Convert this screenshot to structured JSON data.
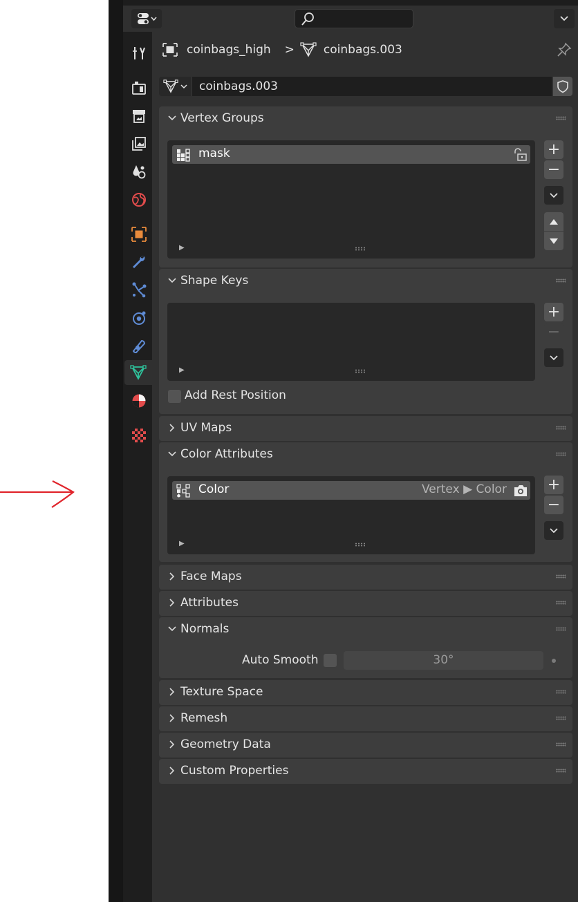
{
  "header": {
    "editor_type_icon": "properties-editor-icon",
    "search_placeholder": "",
    "search_icon": "search-icon",
    "options_icon": "chevron-down-icon"
  },
  "breadcrumb": {
    "object_name": "coinbags_high",
    "separator": ">",
    "mesh_name": "coinbags.003",
    "pin_icon": "pin-icon"
  },
  "datablock": {
    "name": "coinbags.003",
    "fake_user_icon": "shield-icon"
  },
  "property_tabs": [
    {
      "name": "tool",
      "icon": "tool-icon",
      "active": false
    },
    {
      "name": "render",
      "icon": "render-icon",
      "active": false
    },
    {
      "name": "output",
      "icon": "output-icon",
      "active": false
    },
    {
      "name": "view-layer",
      "icon": "view-layer-icon",
      "active": false
    },
    {
      "name": "scene",
      "icon": "scene-icon",
      "active": false
    },
    {
      "name": "world",
      "icon": "world-icon",
      "active": false
    },
    {
      "name": "object",
      "icon": "object-icon",
      "active": false
    },
    {
      "name": "modifiers",
      "icon": "wrench-icon",
      "active": false
    },
    {
      "name": "particles",
      "icon": "particles-icon",
      "active": false
    },
    {
      "name": "physics",
      "icon": "physics-icon",
      "active": false
    },
    {
      "name": "constraints",
      "icon": "constraints-icon",
      "active": false
    },
    {
      "name": "data",
      "icon": "mesh-data-icon",
      "active": true
    },
    {
      "name": "material",
      "icon": "material-icon",
      "active": false
    },
    {
      "name": "texture",
      "icon": "texture-icon",
      "active": false
    }
  ],
  "sections": {
    "vertex_groups": {
      "title": "Vertex Groups",
      "expanded": true,
      "items": [
        {
          "name": "mask",
          "lock_icon": "unlock-icon"
        }
      ]
    },
    "shape_keys": {
      "title": "Shape Keys",
      "expanded": true,
      "items": [],
      "add_rest_position_label": "Add Rest Position",
      "add_rest_position_checked": false
    },
    "uv_maps": {
      "title": "UV Maps",
      "expanded": false
    },
    "color_attributes": {
      "title": "Color Attributes",
      "expanded": true,
      "items": [
        {
          "name": "Color",
          "domain": "Vertex",
          "sep": "▶",
          "type": "Color",
          "render_icon": "camera-icon"
        }
      ]
    },
    "face_maps": {
      "title": "Face Maps",
      "expanded": false
    },
    "attributes": {
      "title": "Attributes",
      "expanded": false
    },
    "normals": {
      "title": "Normals",
      "expanded": true,
      "auto_smooth_label": "Auto Smooth",
      "auto_smooth_checked": false,
      "angle": "30°"
    },
    "texture_space": {
      "title": "Texture Space",
      "expanded": false
    },
    "remesh": {
      "title": "Remesh",
      "expanded": false
    },
    "geometry_data": {
      "title": "Geometry Data",
      "expanded": false
    },
    "custom_properties": {
      "title": "Custom Properties",
      "expanded": false
    }
  },
  "list_controls": {
    "add": "+",
    "remove": "−"
  },
  "annotation": {
    "arrow_color": "#e0242b"
  },
  "colors": {
    "panel_bg": "#303030",
    "section_bg": "#3d3d3d",
    "list_bg": "#282828",
    "row_selected": "#545454",
    "active_tab_icon": "#2ec29b"
  }
}
